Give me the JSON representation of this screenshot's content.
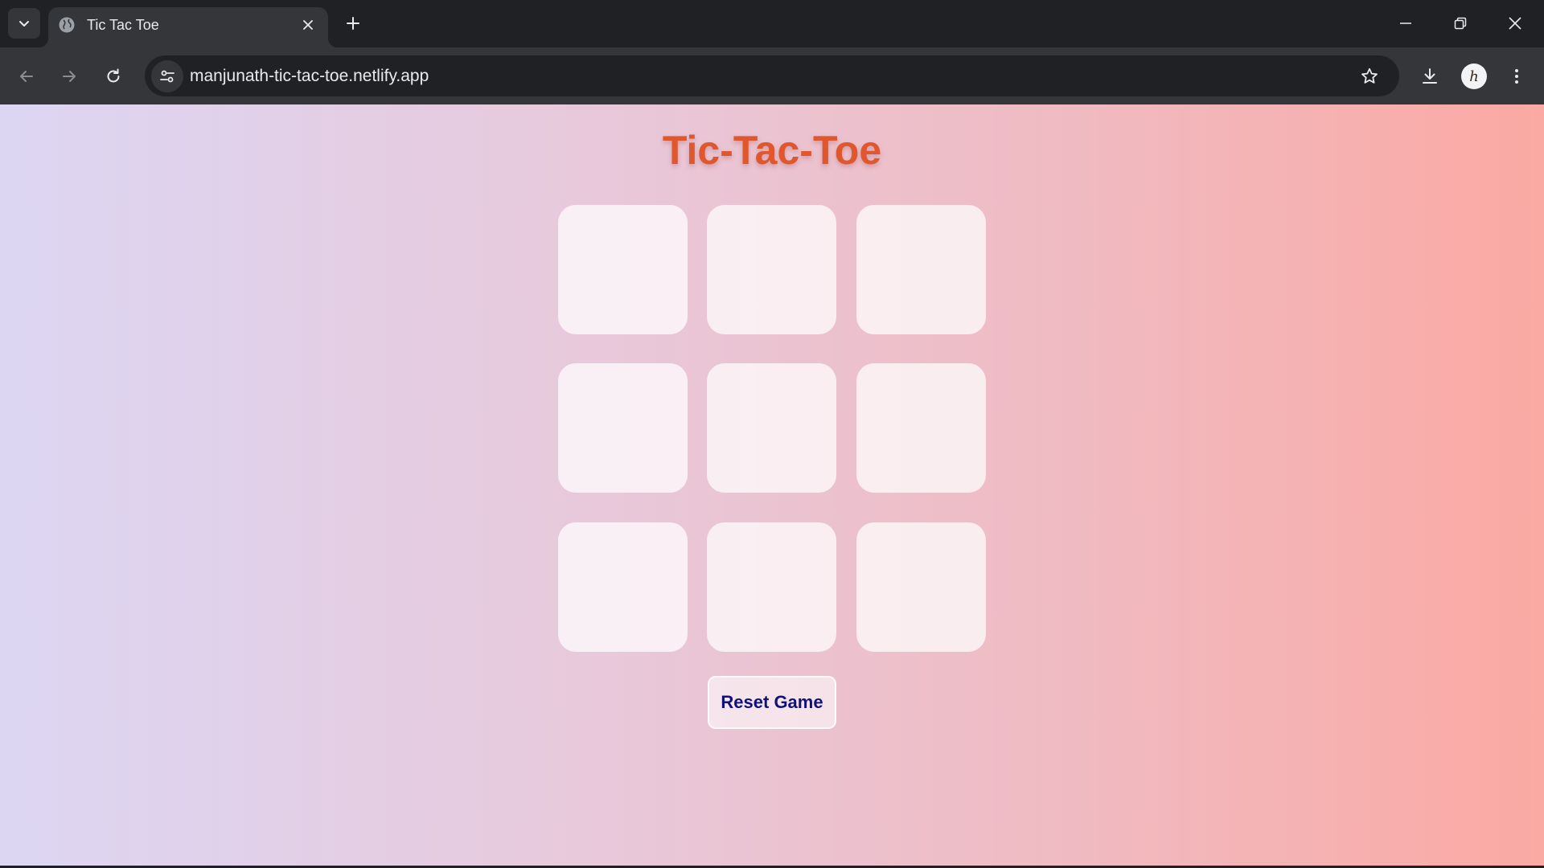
{
  "browser": {
    "tab_title": "Tic Tac Toe",
    "url": "manjunath-tic-tac-toe.netlify.app",
    "profile_initial": "h"
  },
  "game": {
    "title": "Tic-Tac-Toe",
    "cells": [
      "",
      "",
      "",
      "",
      "",
      "",
      "",
      "",
      ""
    ],
    "reset_label": "Reset Game"
  },
  "colors": {
    "title": "#e0572e",
    "button_text": "#10127a",
    "gradient_start": "#dcd6f3",
    "gradient_end": "#fba9a3"
  }
}
